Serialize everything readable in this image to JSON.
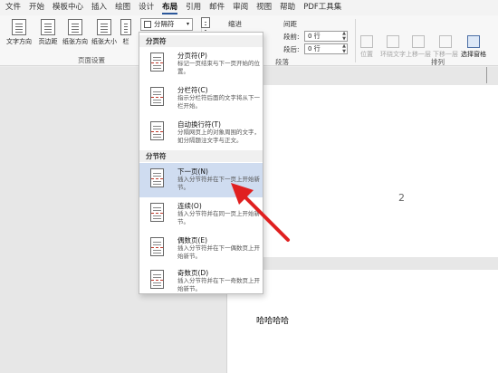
{
  "tabs": [
    "文件",
    "开始",
    "模板中心",
    "插入",
    "绘图",
    "设计",
    "布局",
    "引用",
    "邮件",
    "审阅",
    "视图",
    "帮助",
    "PDF工具集"
  ],
  "active_tab_index": 6,
  "ribbon": {
    "text_direction": "文字方向",
    "margins": "页边距",
    "orientation": "纸张方向",
    "size": "纸张大小",
    "columns": "栏",
    "page_setup_group": "页面设置",
    "breaks": "分隔符",
    "indent_label": "缩进",
    "spacing_label": "间距",
    "before_label": "段前:",
    "before_value": "0 行",
    "after_label": "段后:",
    "after_value": "0 行",
    "paragraph_group": "段落",
    "position": "位置",
    "wrap_text": "环绕文字",
    "bring_forward": "上移一层",
    "send_backward": "下移一层",
    "selection_pane": "选择窗格",
    "arrange_group": "排列"
  },
  "menu": {
    "section_page": "分页符",
    "section_section": "分节符",
    "items": [
      {
        "title": "分页符(P)",
        "desc": "标记一页结束与下一页开始的位置。"
      },
      {
        "title": "分栏符(C)",
        "desc": "指示分栏符后面的文字将从下一栏开始。"
      },
      {
        "title": "自动换行符(T)",
        "desc": "分隔网页上的对象周围的文字，如分隔题注文字与正文。"
      },
      {
        "title": "下一页(N)",
        "desc": "插入分节符并在下一页上开始新节。"
      },
      {
        "title": "连续(O)",
        "desc": "插入分节符并在同一页上开始新节。"
      },
      {
        "title": "偶数页(E)",
        "desc": "插入分节符并在下一偶数页上开始新节。"
      },
      {
        "title": "奇数页(D)",
        "desc": "插入分节符并在下一奇数页上开始新节。"
      }
    ],
    "highlighted_index": 3
  },
  "document": {
    "page_number": "2",
    "body_text": "哈哈哈哈"
  },
  "colors": {
    "accent": "#2b579a",
    "highlight": "#cfdcf0",
    "arrow": "#e02020"
  }
}
